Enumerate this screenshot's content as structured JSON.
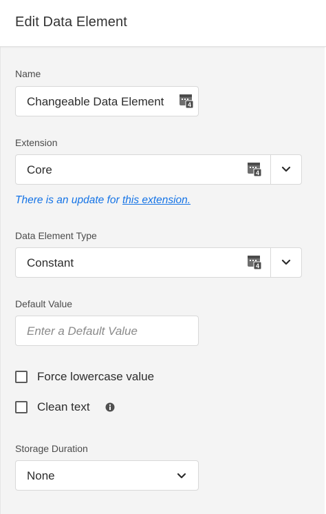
{
  "header": {
    "title": "Edit Data Element"
  },
  "name_field": {
    "label": "Name",
    "value": "Changeable Data Element",
    "icon": "data-element-icon"
  },
  "extension_field": {
    "label": "Extension",
    "value": "Core",
    "icon": "data-element-icon",
    "dropdown_icon": "chevron-down-icon"
  },
  "update_notice": {
    "prefix": "There is an update for ",
    "link_text": "this extension."
  },
  "type_field": {
    "label": "Data Element Type",
    "value": "Constant",
    "icon": "data-element-icon",
    "dropdown_icon": "chevron-down-icon"
  },
  "default_value_field": {
    "label": "Default Value",
    "placeholder": "Enter a Default Value",
    "value": ""
  },
  "options": {
    "force_lowercase": {
      "label": "Force lowercase value",
      "checked": false
    },
    "clean_text": {
      "label": "Clean text",
      "checked": false,
      "info_icon": "info-icon"
    }
  },
  "storage_duration": {
    "label": "Storage Duration",
    "value": "None",
    "dropdown_icon": "chevron-down-icon"
  },
  "colors": {
    "accent": "#1473e6",
    "panel_bg": "#f4f4f4",
    "border": "#d8d8d8"
  }
}
